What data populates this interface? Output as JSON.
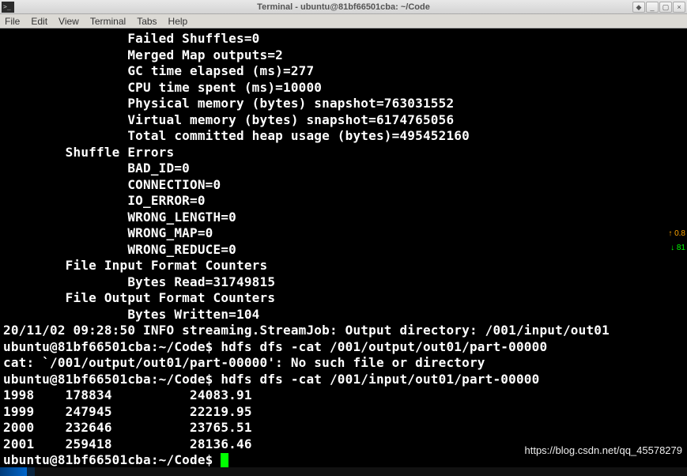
{
  "window": {
    "title": "Terminal - ubuntu@81bf66501cba: ~/Code",
    "icon_glyph": ">_"
  },
  "menubar": {
    "file": "File",
    "edit": "Edit",
    "view": "View",
    "terminal": "Terminal",
    "tabs": "Tabs",
    "help": "Help"
  },
  "window_controls": {
    "stick": "◆",
    "min": "_",
    "max": "▢",
    "close": "×"
  },
  "scroll": {
    "up": "↑ 0.8",
    "down": "↓ 81"
  },
  "term": {
    "l01": "                Failed Shuffles=0",
    "l02": "                Merged Map outputs=2",
    "l03": "                GC time elapsed (ms)=277",
    "l04": "                CPU time spent (ms)=10000",
    "l05": "                Physical memory (bytes) snapshot=763031552",
    "l06": "                Virtual memory (bytes) snapshot=6174765056",
    "l07": "                Total committed heap usage (bytes)=495452160",
    "l08": "        Shuffle Errors",
    "l09": "                BAD_ID=0",
    "l10": "                CONNECTION=0",
    "l11": "                IO_ERROR=0",
    "l12": "                WRONG_LENGTH=0",
    "l13": "                WRONG_MAP=0",
    "l14": "                WRONG_REDUCE=0",
    "l15": "        File Input Format Counters ",
    "l16": "                Bytes Read=31749815",
    "l17": "        File Output Format Counters ",
    "l18": "                Bytes Written=104",
    "l19": "20/11/02 09:28:50 INFO streaming.StreamJob: Output directory: /001/input/out01",
    "l20": "ubuntu@81bf66501cba:~/Code$ hdfs dfs -cat /001/output/out01/part-00000",
    "l21": "cat: `/001/output/out01/part-00000': No such file or directory",
    "l22": "ubuntu@81bf66501cba:~/Code$ hdfs dfs -cat /001/input/out01/part-00000",
    "l23": "1998    178834          24083.91",
    "l24": "1999    247945          22219.95",
    "l25": "2000    232646          23765.51",
    "l26": "2001    259418          28136.46",
    "l27": "ubuntu@81bf66501cba:~/Code$ "
  },
  "watermark": "https://blog.csdn.net/qq_45578279"
}
